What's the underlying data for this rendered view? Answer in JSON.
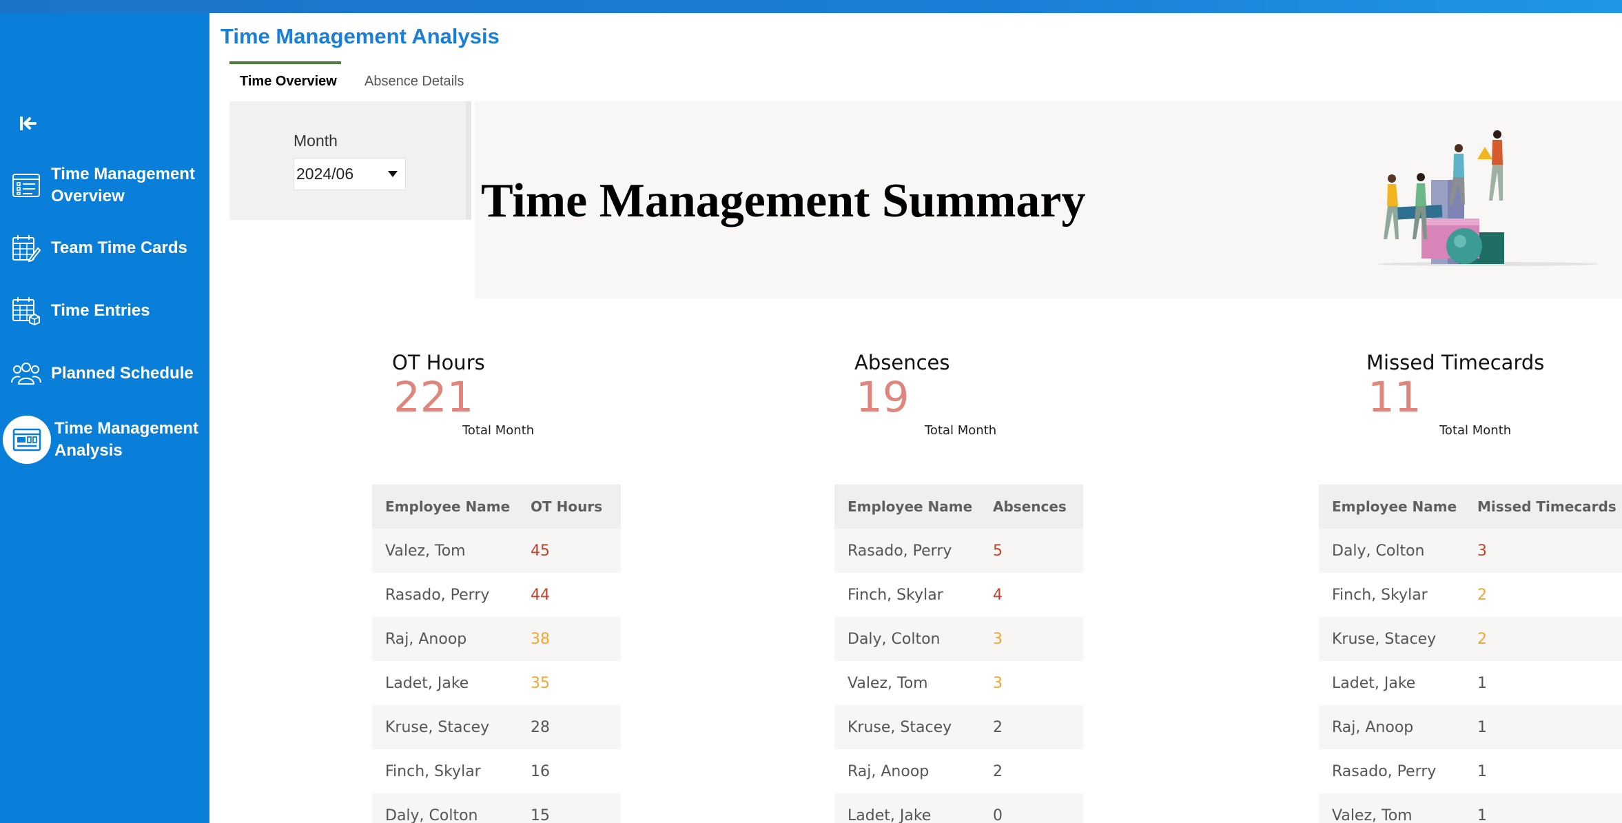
{
  "colors": {
    "sidebar": "#0a7fd9",
    "title": "#1a7fd6",
    "tab_indicator": "#4f7a3c",
    "kpi_value": "#e0857c",
    "high": "#c0452f",
    "medium": "#f0a733"
  },
  "sidebar": {
    "collapse_icon": "collapse-left-icon",
    "items": [
      {
        "label": "Time Management Overview",
        "icon": "overview-list-icon"
      },
      {
        "label": "Team Time Cards",
        "icon": "timecard-edit-icon"
      },
      {
        "label": "Time Entries",
        "icon": "calendar-grid-icon"
      },
      {
        "label": "Planned Schedule",
        "icon": "people-group-icon"
      },
      {
        "label": "Time Management Analysis",
        "icon": "analysis-dashboard-icon",
        "active": true
      }
    ]
  },
  "page": {
    "title": "Time Management Analysis",
    "tabs": [
      {
        "label": "Time Overview",
        "active": true
      },
      {
        "label": "Absence Details",
        "active": false
      }
    ]
  },
  "filter": {
    "label": "Month",
    "value": "2024/06"
  },
  "banner": {
    "title": "Time Management Summary",
    "illustration": "team-building-blocks-illustration"
  },
  "kpis": [
    {
      "label": "OT Hours",
      "value": "221",
      "sub": "Total Month"
    },
    {
      "label": "Absences",
      "value": "19",
      "sub": "Total Month"
    },
    {
      "label": "Missed Timecards",
      "value": "11",
      "sub": "Total Month"
    }
  ],
  "tables": {
    "ot": {
      "headers": [
        "Employee Name",
        "OT Hours"
      ],
      "rows": [
        {
          "name": "Valez, Tom",
          "value": "45",
          "level": "high"
        },
        {
          "name": "Rasado, Perry",
          "value": "44",
          "level": "high"
        },
        {
          "name": "Raj, Anoop",
          "value": "38",
          "level": "medium"
        },
        {
          "name": "Ladet, Jake",
          "value": "35",
          "level": "medium"
        },
        {
          "name": "Kruse, Stacey",
          "value": "28",
          "level": "normal"
        },
        {
          "name": "Finch, Skylar",
          "value": "16",
          "level": "normal"
        },
        {
          "name": "Daly, Colton",
          "value": "15",
          "level": "normal"
        }
      ]
    },
    "absences": {
      "headers": [
        "Employee Name",
        "Absences"
      ],
      "rows": [
        {
          "name": "Rasado, Perry",
          "value": "5",
          "level": "high"
        },
        {
          "name": "Finch, Skylar",
          "value": "4",
          "level": "high"
        },
        {
          "name": "Daly, Colton",
          "value": "3",
          "level": "medium"
        },
        {
          "name": "Valez, Tom",
          "value": "3",
          "level": "medium"
        },
        {
          "name": "Kruse, Stacey",
          "value": "2",
          "level": "normal"
        },
        {
          "name": "Raj, Anoop",
          "value": "2",
          "level": "normal"
        },
        {
          "name": "Ladet, Jake",
          "value": "0",
          "level": "normal"
        }
      ]
    },
    "missed": {
      "headers": [
        "Employee Name",
        "Missed Timecards"
      ],
      "rows": [
        {
          "name": "Daly, Colton",
          "value": "3",
          "level": "high"
        },
        {
          "name": "Finch, Skylar",
          "value": "2",
          "level": "medium"
        },
        {
          "name": "Kruse, Stacey",
          "value": "2",
          "level": "medium"
        },
        {
          "name": "Ladet, Jake",
          "value": "1",
          "level": "normal"
        },
        {
          "name": "Raj, Anoop",
          "value": "1",
          "level": "normal"
        },
        {
          "name": "Rasado, Perry",
          "value": "1",
          "level": "normal"
        },
        {
          "name": "Valez, Tom",
          "value": "1",
          "level": "normal"
        }
      ]
    }
  }
}
